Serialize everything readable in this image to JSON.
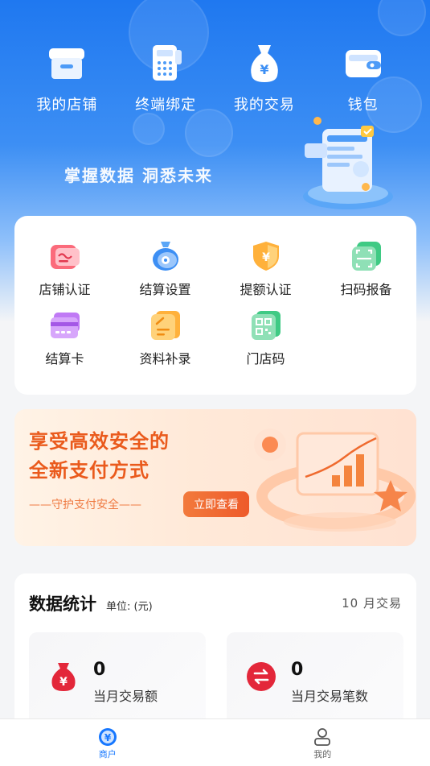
{
  "top_menu": [
    {
      "label": "我的店铺",
      "icon": "store-icon"
    },
    {
      "label": "终端绑定",
      "icon": "pos-terminal-icon"
    },
    {
      "label": "我的交易",
      "icon": "money-bag-icon"
    },
    {
      "label": "钱包",
      "icon": "wallet-icon"
    }
  ],
  "hero": {
    "slogan": "掌握数据 洞悉未来"
  },
  "services": [
    {
      "label": "店铺认证",
      "icon": "store-certification-icon"
    },
    {
      "label": "结算设置",
      "icon": "settlement-settings-icon"
    },
    {
      "label": "提额认证",
      "icon": "limit-increase-shield-icon"
    },
    {
      "label": "扫码报备",
      "icon": "scan-code-icon"
    },
    {
      "label": "结算卡",
      "icon": "bank-card-icon"
    },
    {
      "label": "资料补录",
      "icon": "document-edit-icon"
    },
    {
      "label": "门店码",
      "icon": "qr-code-icon"
    }
  ],
  "banner": {
    "title_line1": "享受高效安全的",
    "title_line2": "全新支付方式",
    "subtitle": "——守护支付安全——",
    "button": "立即查看"
  },
  "stats": {
    "title": "数据统计",
    "unit": "单位: (元)",
    "month": "10 月交易",
    "items": [
      {
        "value": "0",
        "label": "当月交易额",
        "icon": "yuan-bag-icon"
      },
      {
        "value": "0",
        "label": "当月交易笔数",
        "icon": "transfer-arrows-icon"
      }
    ]
  },
  "tabs": [
    {
      "label": "商户",
      "icon": "merchant-icon",
      "active": true
    },
    {
      "label": "我的",
      "icon": "profile-icon",
      "active": false
    }
  ],
  "colors": {
    "primary": "#1f78f0",
    "accent_orange": "#ea5a1c",
    "active_tab": "#1677ff",
    "inactive_tab": "#666666"
  }
}
